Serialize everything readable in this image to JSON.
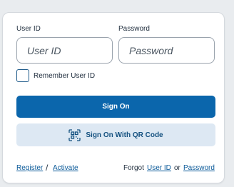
{
  "login": {
    "user_id_label": "User ID",
    "user_id_placeholder": "User ID",
    "password_label": "Password",
    "password_placeholder": "Password",
    "remember_label": "Remember User ID",
    "sign_on_label": "Sign On",
    "qr_label": "Sign On With QR Code",
    "register_link": "Register",
    "slash": "/",
    "activate_link": "Activate",
    "forgot_text": "Forgot",
    "forgot_user_id_link": "User ID",
    "or_text": "or",
    "forgot_password_link": "Password"
  },
  "icons": {
    "qr": "qr-code-icon"
  },
  "colors": {
    "primary": "#0b66ac",
    "secondary_bg": "#dde8f3",
    "link": "#0b5a99"
  }
}
